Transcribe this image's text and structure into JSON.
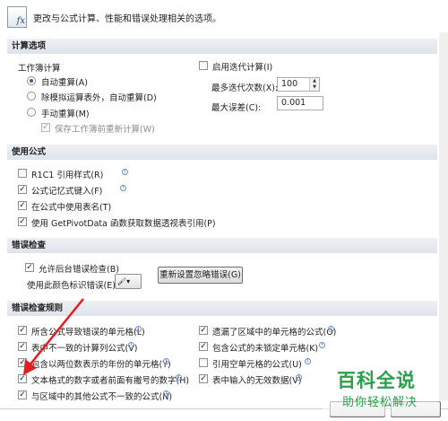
{
  "header": {
    "icon": "fx-formula-icon",
    "text": "更改与公式计算、性能和错误处理相关的选项。"
  },
  "sections": {
    "calc": "计算选项",
    "formulas": "使用公式",
    "errcheck": "错误检查",
    "errrules": "错误检查规则"
  },
  "calc": {
    "workbook_label": "工作簿计算",
    "auto": "自动重算(A)",
    "auto_except": "除模拟运算表外，自动重算(D)",
    "manual": "手动重算(M)",
    "save_recalc": "保存工作簿前重新计算(W)",
    "iterative": "启用迭代计算(I)",
    "max_iter_label": "最多迭代次数(X):",
    "max_iter_value": "100",
    "max_change_label": "最大误差(C):",
    "max_change_value": "0.001"
  },
  "formulas": {
    "r1c1": "R1C1 引用样式(R)",
    "autocomplete": "公式记忆式键入(F)",
    "table_names": "在公式中使用表名(T)",
    "getpivot": "使用 GetPivotData 函数获取数据透视表引用(P)"
  },
  "errcheck": {
    "background": "允许后台错误检查(B)",
    "color_label": "使用此颜色标识错误(E):",
    "reset": "重新设置忽略错误(G)"
  },
  "errrules": {
    "left": [
      "所含公式导致错误的单元格(L)",
      "表中不一致的计算列公式(V)",
      "包含以两位数表示的年份的单元格(Y)",
      "文本格式的数字或者前面有撇号的数字(H)",
      "与区域中的其他公式不一致的公式(N)"
    ],
    "right": [
      "遗漏了区域中的单元格的公式(O)",
      "包含公式的未锁定单元格(K)",
      "引用空单元格的公式(U)",
      "表中输入的无效数据(V)"
    ]
  },
  "watermark": {
    "title": "百科全说",
    "subtitle": "助你轻松解决"
  },
  "colors": {
    "section_bg": "#e3e6ec",
    "arrow": "#e02020",
    "watermark": "#2aa04a"
  }
}
